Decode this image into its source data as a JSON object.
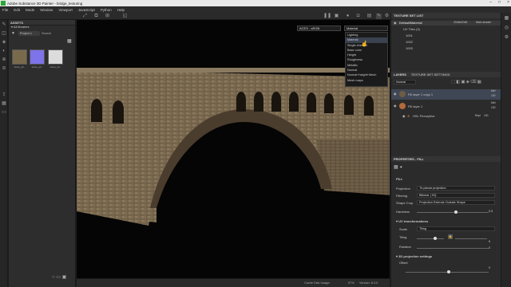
{
  "window": {
    "title": "Adobe Substance 3D Painter - bridge_texturing"
  },
  "menu": [
    "File",
    "Edit",
    "Mode",
    "Window",
    "Viewport",
    "JavaScript",
    "Python",
    "Help"
  ],
  "assets": {
    "header": "ASSETS",
    "all_libraries": "All libraries",
    "filter_chip": "Project x",
    "search_placeholder": "Search",
    "thumbs": [
      {
        "label": "stone_ph...",
        "color": "#7a6a4c"
      },
      {
        "label": "stone_ph...",
        "color": "#7e73e8"
      },
      {
        "label": "stone_ph...",
        "color": "#dcdcdc"
      }
    ]
  },
  "viewport": {
    "colorspace": "ACES - sRGB",
    "channel": "Material",
    "menu": [
      "Lighting",
      "Material",
      "Single channel",
      "Base color",
      "Height",
      "Roughness",
      "Metallic",
      "Normal",
      "Normal+height+Mesh",
      "Mesh maps"
    ],
    "selected_index": 1
  },
  "texture_set_list": {
    "header": "TEXTURE SET LIST",
    "material": "DefaultMaterial",
    "resolution": "2048x2048",
    "shader": "Main shader",
    "uv_tiles": "UV Tiles (3)",
    "tiles": [
      "1001",
      "1002",
      "1003"
    ]
  },
  "layers": {
    "tab1": "LAYERS",
    "tab2": "TEXTURE SET SETTINGS",
    "blend": "Normal",
    "items": [
      {
        "name": "Fill layer 1 copy 1",
        "mode": "Mtrl",
        "opacity": "100"
      },
      {
        "name": "Fill layer 1",
        "mode": "Mtrl",
        "opacity": "100"
      },
      {
        "name": "HSL Perceptive",
        "mode": "Repl",
        "opacity": "100"
      }
    ]
  },
  "properties": {
    "header": "PROPERTIES - FILL",
    "section_fill": "FILL",
    "projection_label": "Projection",
    "projection_value": "Tri-planar projection",
    "filtering_label": "Filtering",
    "filtering_value": "Bilinear | HQ",
    "shape_crop_label": "Shape Crop",
    "shape_crop_value": "Projection Extends Outside Shape",
    "hardness_label": "Hardness",
    "hardness_value": "0.5",
    "uv_section": "UV transformations",
    "scale_label": "Scale",
    "scale_value": "Tiling",
    "tiling_label": "Tiling",
    "tiling_value": "6",
    "rotation_label": "Rotation",
    "rotation_value": "0",
    "proj3d_section": "3D projection settings",
    "offset_label": "Offset",
    "offset_value": "0"
  },
  "status": {
    "cache": "Cache Disk Usage:",
    "percent": "57%",
    "version": "Version: 8.3.0"
  }
}
